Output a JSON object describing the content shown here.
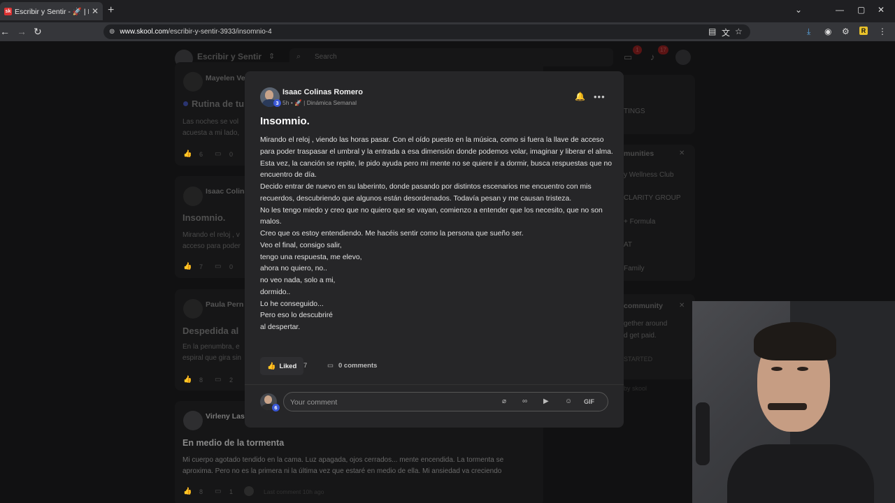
{
  "browser": {
    "tab_title": "Escribir y Sentir - 🚀 | Dinámica",
    "tab_favicon": "sk",
    "url_host": "www.skool.com",
    "url_path": "/escribir-y-sentir-3933/insomnio-4"
  },
  "background": {
    "group_name": "Escribir y Sentir",
    "search_placeholder": "Search",
    "chat_badge": "1",
    "notif_badge": "17",
    "posts": [
      {
        "author": "Mayelen Ve",
        "title": "Rutina de tu",
        "excerpt1": "Las noches se vol",
        "excerpt2": "acuesta a mi lado,",
        "likes": "6",
        "comments": "0"
      },
      {
        "author": "Isaac Colina",
        "title": "Insomnio.",
        "excerpt1": "Mirando el reloj , v",
        "excerpt2": "acceso para poder",
        "likes": "7",
        "comments": "0"
      },
      {
        "author": "Paula Pern",
        "title": "Despedida al ",
        "excerpt1": "En la penumbra, e",
        "excerpt2": "espiral que gira sin",
        "likes": "8",
        "comments": "2"
      },
      {
        "author": "Virleny Lass",
        "title": "En medio de la tormenta",
        "excerpt1": "Mi cuerpo agotado tendido en la cama. Luz apagada, ojos cerrados... mente encendida. La tormenta se",
        "excerpt2": "aproxima. Pero no es la primera ni la última vez que estaré en medio de ella. Mi ansiedad va creciendo",
        "likes": "8",
        "comments": "1",
        "last_comment": "Last comment 10h ago"
      }
    ],
    "right": {
      "settings": "TINGS",
      "communities_title": "munities",
      "communities": [
        "y Wellness Club",
        "CLARITY GROUP",
        "+ Formula",
        "AT",
        "Family"
      ],
      "create_title": "community",
      "create_text1": "gether around",
      "create_text2": "d get paid.",
      "create_btn": "STARTED",
      "powered": "by skool"
    }
  },
  "post": {
    "author": "Isaac Colinas Romero",
    "level": "3",
    "time": "5h",
    "category": "| Dinámica Semanal",
    "title": "Insomnio.",
    "paragraphs": [
      "Mirando el reloj , viendo las horas pasar. Con el oído puesto en la música, como si fuera la llave de acceso para poder traspasar el umbral y la entrada a esa dimensión donde podemos volar, imaginar y liberar el alma.",
      "Esta vez, la canción se repite, le pido ayuda pero mi mente no se quiere ir a dormir, busca respuestas que no encuentro de día.",
      "Decido entrar de nuevo en su laberinto, donde pasando por distintos escenarios me encuentro con mis recuerdos, descubriendo que algunos están desordenados. Todavía pesan y me causan tristeza.",
      "No les tengo miedo y creo que no quiero que se vayan, comienzo a entender que los necesito, que no son malos.",
      "Creo que os estoy entendiendo. Me hacéis sentir como la persona que sueño ser.",
      "Veo el final, consigo salir,",
      "tengo una respuesta, me elevo,",
      "ahora no quiero, no..",
      "no veo nada, solo a mi,",
      "dormido..",
      "Lo he conseguido...",
      "Pero eso lo descubriré",
      "al despertar."
    ],
    "liked_label": "Liked",
    "like_count": "7",
    "comments_label": "0 comments",
    "comment_placeholder": "Your comment",
    "commenter_level": "6",
    "gif_label": "GIF"
  }
}
